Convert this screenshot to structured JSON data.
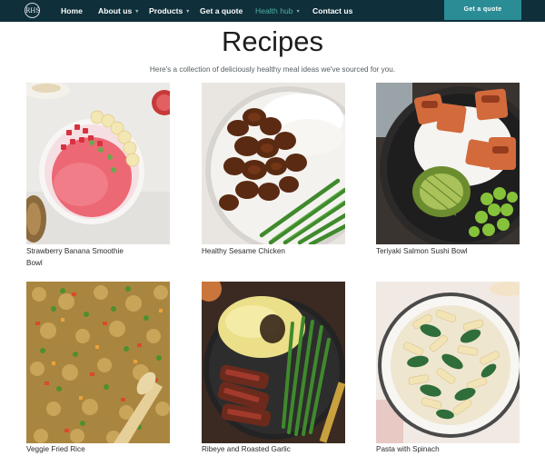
{
  "brand": {
    "logo_text": "RHS"
  },
  "nav": {
    "items": [
      {
        "label": "Home",
        "caret": ""
      },
      {
        "label": "About us",
        "caret": "▾"
      },
      {
        "label": "Products",
        "caret": "▾"
      },
      {
        "label": "Get a quote",
        "caret": ""
      },
      {
        "label": "Health hub",
        "caret": "▾"
      },
      {
        "label": "Contact us",
        "caret": ""
      }
    ],
    "active": "Health hub",
    "cta_label": "Get a quote"
  },
  "page": {
    "title": "Recipes",
    "subtitle": "Here's a collection of deliciously healthy meal ideas we've sourced for you."
  },
  "recipes": [
    {
      "title_line1": "Strawberry Banana Smoothie",
      "title_line2": "Bowl"
    },
    {
      "title_line1": "Healthy Sesame Chicken",
      "title_line2": ""
    },
    {
      "title_line1": "Teriyaki Salmon Sushi Bowl",
      "title_line2": ""
    },
    {
      "title_line1": "Veggie Fried Rice",
      "title_line2": ""
    },
    {
      "title_line1": "Ribeye and Roasted Garlic",
      "title_line2": ""
    },
    {
      "title_line1": "Pasta with Spinach",
      "title_line2": ""
    }
  ],
  "colors": {
    "nav_bg": "#0f2f3a",
    "cta_bg": "#2a8c95",
    "active_link": "#4fb0a4"
  }
}
